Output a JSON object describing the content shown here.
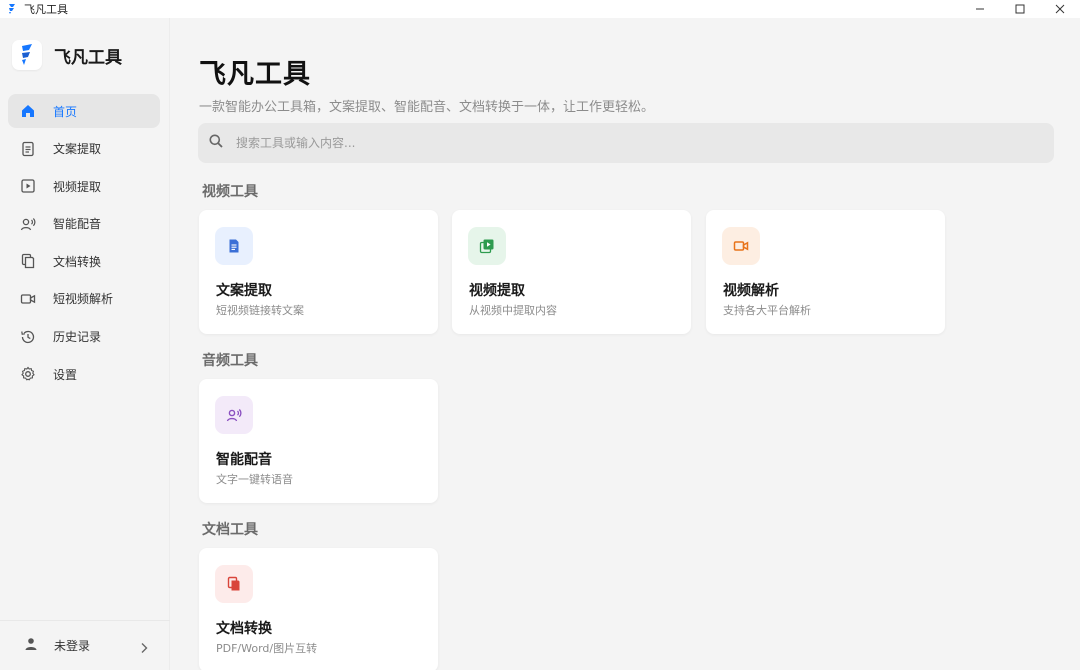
{
  "window": {
    "title": "飞凡工具"
  },
  "brand": {
    "name": "飞凡工具",
    "accent": "#1677ff"
  },
  "sidebar": {
    "items": [
      {
        "label": "首页",
        "icon": "home-icon",
        "active": true
      },
      {
        "label": "文案提取",
        "icon": "document-icon"
      },
      {
        "label": "视频提取",
        "icon": "video-frame-icon"
      },
      {
        "label": "智能配音",
        "icon": "voice-icon"
      },
      {
        "label": "文档转换",
        "icon": "copy-icon"
      },
      {
        "label": "短视频解析",
        "icon": "camera-icon"
      },
      {
        "label": "历史记录",
        "icon": "history-icon"
      },
      {
        "label": "设置",
        "icon": "gear-icon"
      }
    ],
    "footer": {
      "label": "未登录"
    }
  },
  "main": {
    "title": "飞凡工具",
    "subtitle": "一款智能办公工具箱，文案提取、智能配音、文档转换于一体，让工作更轻松。",
    "search": {
      "placeholder": "搜索工具或输入内容..."
    },
    "sections": [
      {
        "title": "视频工具",
        "cards": [
          {
            "title": "文案提取",
            "desc": "短视频链接转文案",
            "icon": "document-icon",
            "color": "#3b6fd6",
            "bg": "#e8f0fe"
          },
          {
            "title": "视频提取",
            "desc": "从视频中提取内容",
            "icon": "video-frame-icon",
            "color": "#2e9b4f",
            "bg": "#e6f5ea"
          },
          {
            "title": "视频解析",
            "desc": "支持各大平台解析",
            "icon": "camera-icon",
            "color": "#e8731a",
            "bg": "#fdeee2"
          }
        ]
      },
      {
        "title": "音频工具",
        "cards": [
          {
            "title": "智能配音",
            "desc": "文字一键转语音",
            "icon": "voice-icon",
            "color": "#8a4fc0",
            "bg": "#f3eaf9"
          }
        ]
      },
      {
        "title": "文档工具",
        "cards": [
          {
            "title": "文档转换",
            "desc": "PDF/Word/图片互转",
            "icon": "copy-icon",
            "color": "#d9443a",
            "bg": "#fdebea"
          }
        ]
      }
    ]
  }
}
